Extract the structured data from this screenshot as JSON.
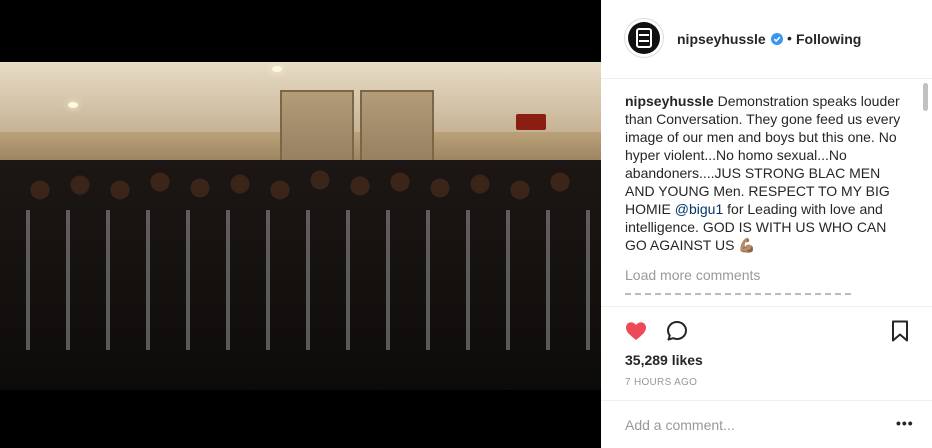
{
  "post": {
    "username": "nipseyhussle",
    "follow_status": "Following",
    "separator": "•",
    "caption_username": "nipseyhussle",
    "caption_text": " Demonstration speaks louder than Conversation. They gone feed us every image of our men and boys but this one. No hyper violent...No homo sexual...No abandoners....JUS STRONG BLAC MEN AND YOUNG Men. RESPECT TO MY BIG HOMIE ",
    "caption_mention": "@bigu1",
    "caption_text_end": " for Leading with love and intelligence. GOD IS WITH US WHO CAN GO AGAINST US ",
    "caption_emoji": "💪🏽",
    "load_more": "Load more comments",
    "likes": "35,289 likes",
    "time": "7 HOURS AGO",
    "add_comment_placeholder": "Add a comment...",
    "more_options": "•••"
  },
  "icons": {
    "like": "heart-icon",
    "comment": "comment-icon",
    "save": "bookmark-icon",
    "verified": "verified-badge-icon",
    "more": "more-options-icon"
  },
  "colors": {
    "like_red": "#ed4956",
    "verified_blue": "#3897f0",
    "text_dark": "#262626",
    "text_grey": "#999999",
    "mention_blue": "#003569"
  }
}
